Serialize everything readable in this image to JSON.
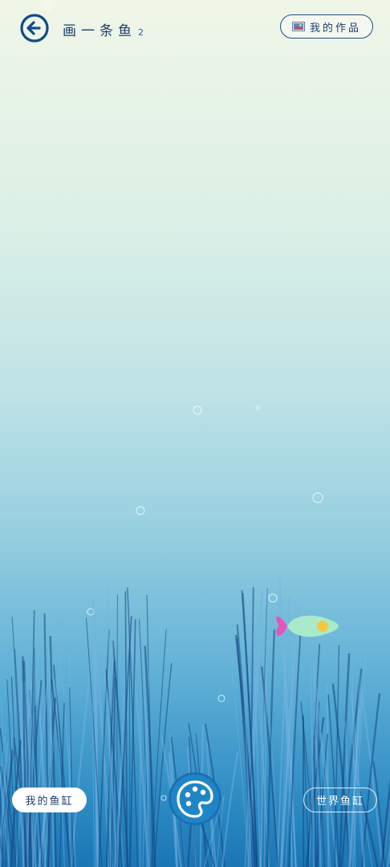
{
  "header": {
    "title": "画一条鱼",
    "title_suffix": "2",
    "works_label": "我的作品",
    "works_icon": "picture-icon",
    "back_icon": "back-arrow-icon"
  },
  "footer": {
    "my_tank_label": "我的鱼缸",
    "world_tank_label": "世界鱼缸",
    "palette_icon": "palette-icon"
  },
  "fish": {
    "body_color": "#a8eacb",
    "tail_color": "#e356b8",
    "eye_color": "#f5c842"
  },
  "theme": {
    "primary": "#1b5fa0",
    "text": "#1b3d6d"
  }
}
